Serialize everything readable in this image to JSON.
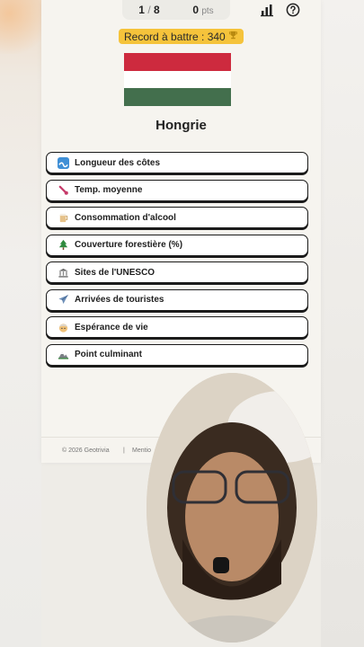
{
  "header": {
    "question_current": "1",
    "question_total": "8",
    "points": "0",
    "points_unit": "pts"
  },
  "record": {
    "label": "Record à battre : 340",
    "icon": "trophy-icon"
  },
  "flag": {
    "colors": [
      "#cd2a3e",
      "#ffffff",
      "#436f4d"
    ]
  },
  "country": "Hongrie",
  "options": [
    {
      "label": "Longueur des côtes",
      "icon": "wave-icon"
    },
    {
      "label": "Temp. moyenne",
      "icon": "thermometer-icon"
    },
    {
      "label": "Consommation d'alcool",
      "icon": "beer-icon"
    },
    {
      "label": "Couverture forestière (%)",
      "icon": "tree-icon"
    },
    {
      "label": "Sites de l'UNESCO",
      "icon": "monument-icon"
    },
    {
      "label": "Arrivées de touristes",
      "icon": "airplane-icon"
    },
    {
      "label": "Espérance de vie",
      "icon": "face-icon"
    },
    {
      "label": "Point culminant",
      "icon": "mountain-icon"
    }
  ],
  "footer": {
    "copyright": "© 2026 Geotrivia",
    "separator": "|",
    "legal": "Mentio"
  }
}
